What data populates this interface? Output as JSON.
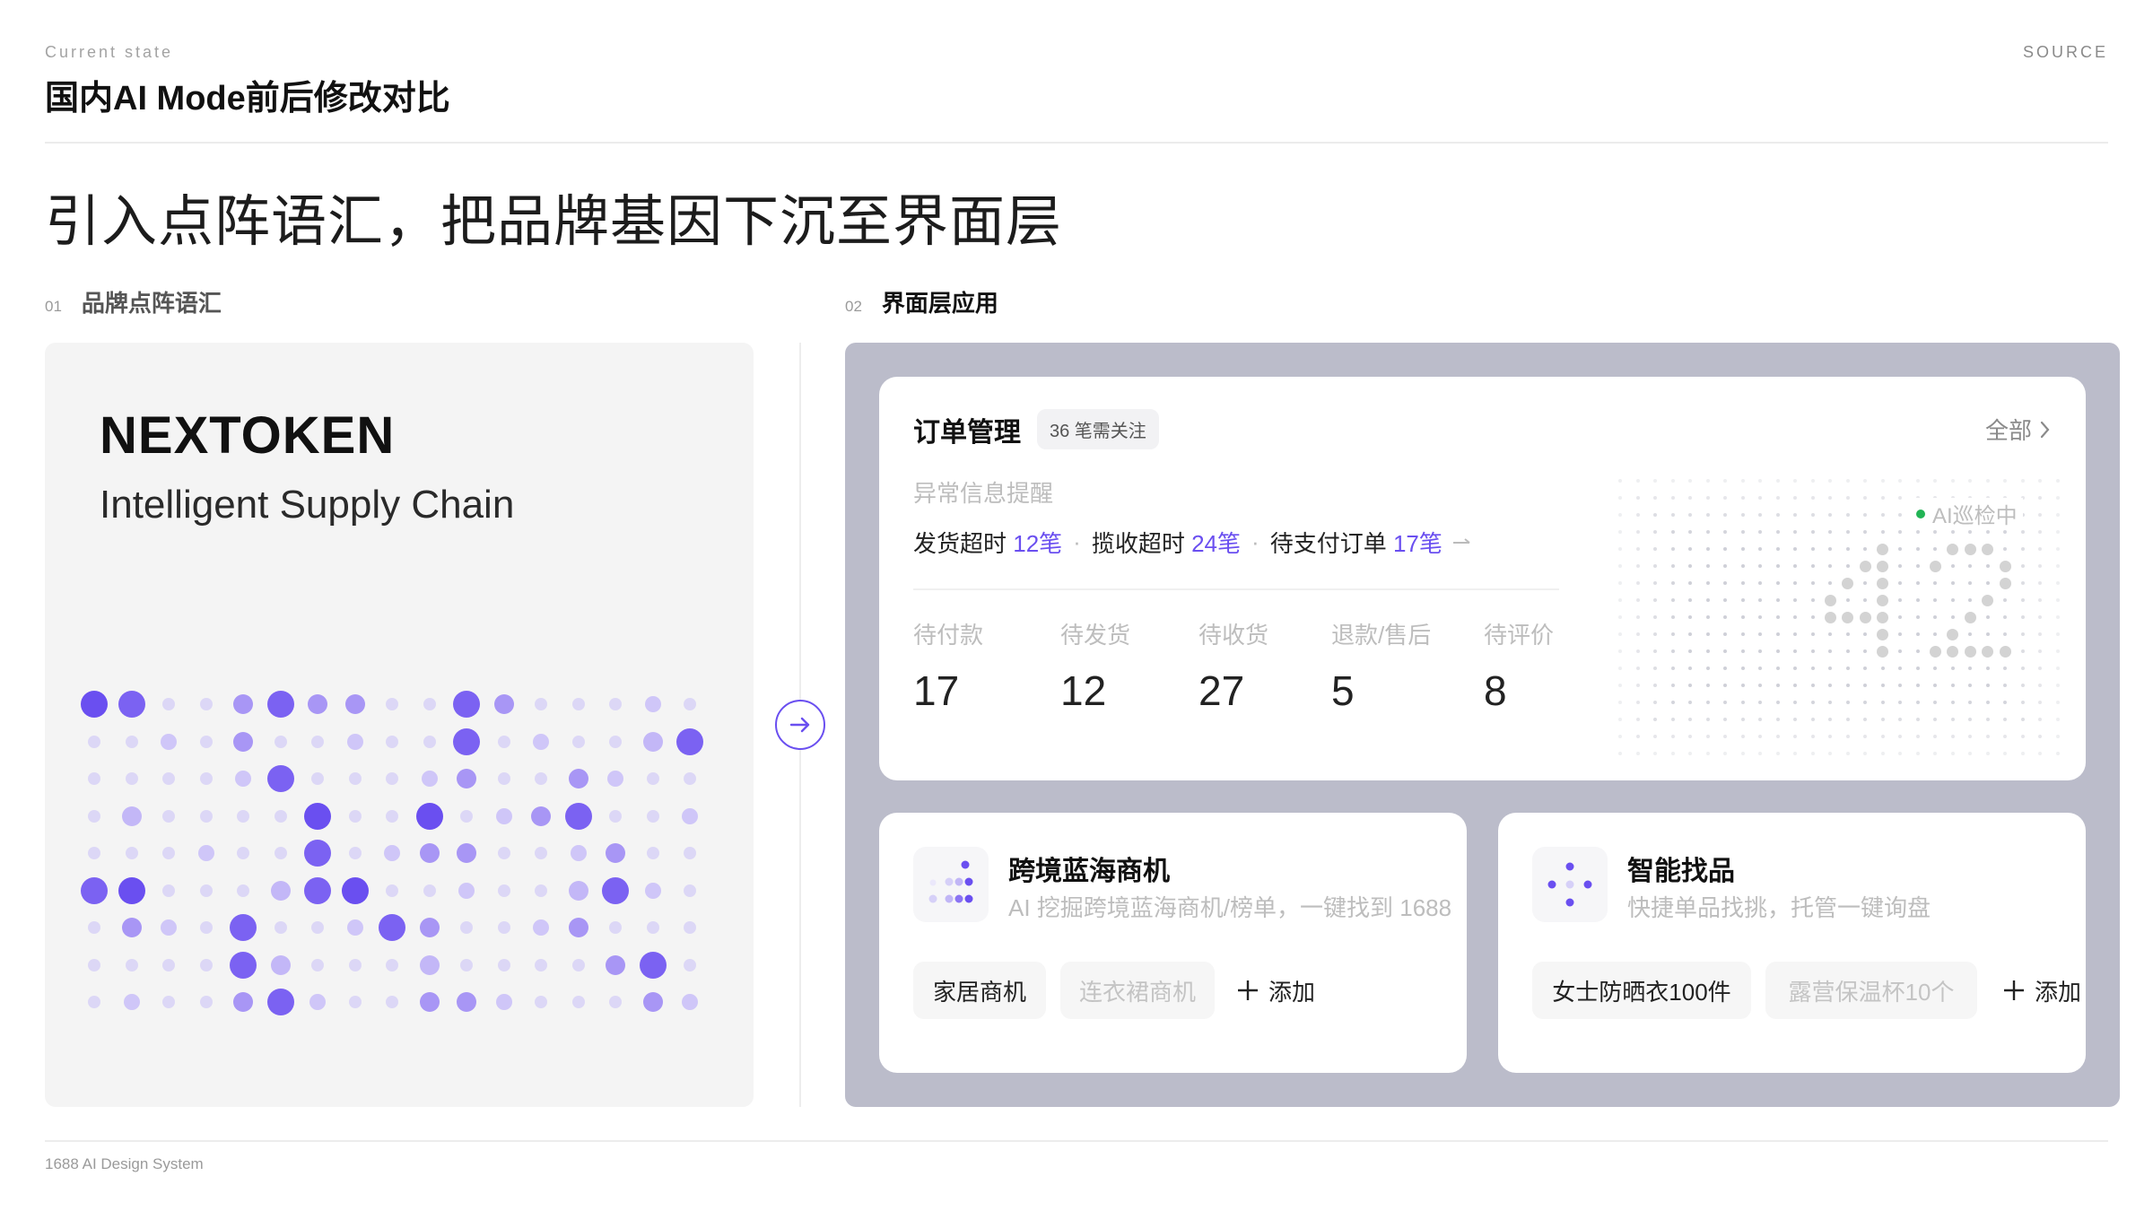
{
  "header": {
    "eyebrow": "Current state",
    "title": "国内AI Mode前后修改对比",
    "source": "SOURCE"
  },
  "headline": "引入点阵语汇，把品牌基因下沉至界面层",
  "sections": [
    {
      "num": "01",
      "label": "品牌点阵语汇"
    },
    {
      "num": "02",
      "label": "界面层应用"
    }
  ],
  "brand": {
    "name": "NEXTOKEN",
    "tagline": "Intelligent Supply Chain"
  },
  "order_card": {
    "title": "订单管理",
    "badge": "36 笔需关注",
    "all_link": "全部",
    "alert_title": "异常信息提醒",
    "alerts": [
      {
        "label": "发货超时",
        "count": "12笔"
      },
      {
        "label": "揽收超时",
        "count": "24笔"
      },
      {
        "label": "待支付订单",
        "count": "17笔"
      }
    ],
    "stats": [
      {
        "label": "待付款",
        "value": "17"
      },
      {
        "label": "待发货",
        "value": "12"
      },
      {
        "label": "待收货",
        "value": "27"
      },
      {
        "label": "退款/售后",
        "value": "5"
      },
      {
        "label": "待评价",
        "value": "8"
      }
    ],
    "ai_status": "AI巡检中"
  },
  "feature_cards": [
    {
      "title": "跨境蓝海商机",
      "desc": "AI 挖掘跨境蓝海商机/榜单，一键找到 1688",
      "tags": [
        "家居商机",
        "连衣裙商机"
      ],
      "add_label": "添加"
    },
    {
      "title": "智能找品",
      "desc": "快捷单品找挑，托管一键询盘",
      "tags": [
        "女士防晒衣100件",
        "露营保温杯10个"
      ],
      "add_label": "添加"
    }
  ],
  "footer": "1688 AI Design System",
  "colors": {
    "accent": "#6a4ff0",
    "panel_bg": "#bbbcca",
    "left_panel_bg": "#f4f4f4",
    "status_green": "#22b455"
  },
  "icons": {
    "arrow_button": "arrow-right-circle-icon",
    "chevron": "chevron-right-icon",
    "plus": "plus-icon"
  }
}
